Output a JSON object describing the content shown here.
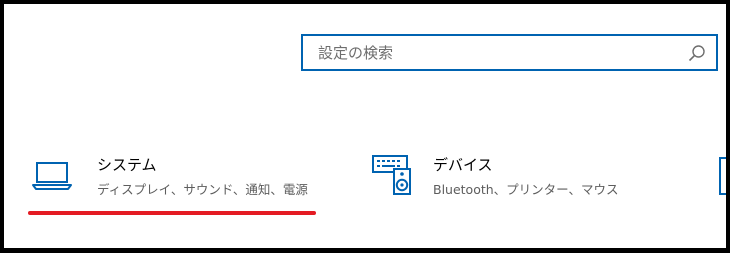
{
  "search": {
    "placeholder": "設定の検索",
    "value": ""
  },
  "categories": [
    {
      "title": "システム",
      "description": "ディスプレイ、サウンド、通知、電源",
      "icon": "laptop-icon"
    },
    {
      "title": "デバイス",
      "description": "Bluetooth、プリンター、マウス",
      "icon": "keyboard-speaker-icon"
    }
  ],
  "colors": {
    "accent": "#0063b1",
    "highlight": "#e41b23",
    "border": "#000000"
  }
}
